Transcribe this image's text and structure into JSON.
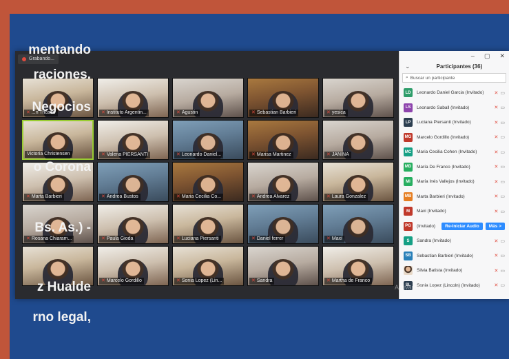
{
  "background_text": [
    "mentando",
    "raciones.",
    "Negocios",
    "o Corona",
    "Bs.  As.)  -",
    "z  Hualde",
    "rno  legal,"
  ],
  "recording": {
    "label": "Grabando..."
  },
  "window_controls": {
    "minimize": "–",
    "maximize": "▢",
    "close": "✕"
  },
  "panel": {
    "title": "Participantes (36)",
    "search_placeholder": "Buscar un participante",
    "participants": [
      {
        "initials": "LD",
        "color": "#2e9d6a",
        "name": "Leonardo Daniel Garcia (Invitado)"
      },
      {
        "initials": "LS",
        "color": "#8e44ad",
        "name": "Leonardo Saball (Invitado)"
      },
      {
        "initials": "LP",
        "color": "#2c3e50",
        "name": "Luciana Piersanti (Invitado)"
      },
      {
        "initials": "MG",
        "color": "#c0392b",
        "name": "Marcelo Gordillo (Invitado)"
      },
      {
        "initials": "MC",
        "color": "#16a085",
        "name": "Maria Cecilia Cohen (Invitado)"
      },
      {
        "initials": "MD",
        "color": "#27ae60",
        "name": "María De Franco (Invitado)"
      },
      {
        "initials": "MI",
        "color": "#27ae60",
        "name": "María Inés Vallejos (Invitado)"
      },
      {
        "initials": "MB",
        "color": "#e67e22",
        "name": "Marta Barbieri (Invitado)"
      },
      {
        "initials": "M",
        "color": "#c0392b",
        "name": "Maxi (Invitado)"
      },
      {
        "initials": "PG",
        "color": "#c0392b",
        "name": "(Invitado)",
        "buttons": [
          "Re-Iniciar Audio",
          "Más >"
        ]
      },
      {
        "initials": "S",
        "color": "#16a085",
        "name": "Sandra (Invitado)"
      },
      {
        "initials": "SB",
        "color": "#2980b9",
        "name": "Sebastian Barbieri (Invitado)"
      },
      {
        "initials": "",
        "color": "#e8d9c8",
        "name": "Silvia Batista (Invitado)",
        "photo": true
      },
      {
        "initials": "SL",
        "color": "#2c3e50",
        "name": "Sonia Lopez (Lincoln) (Invitado)"
      }
    ]
  },
  "tiles": [
    "...n Tricado",
    "Instituto Argentin...",
    "Agustin",
    "Sebastian Barbieri",
    "yesica",
    "Victoria Christensen",
    "Valeria PIERSANTI",
    "Leonardo Daniel...",
    "Marisa Martinez",
    "JANINA",
    "Marta Barbieri",
    "Andrea Bustos",
    "Maria Cecilia Co...",
    "Andrea Alvarez",
    "Laura Gonzalez",
    "Rosana Chiaram...",
    "Paula Gioda",
    "Luciana Piersanti",
    "Daniel ferrer",
    "Maxi",
    "",
    "Marcelo Gordillo",
    "Sonia Lopez (Lin...",
    "Sandra",
    "Martha de Franco"
  ],
  "watermark": "Activar Windows"
}
